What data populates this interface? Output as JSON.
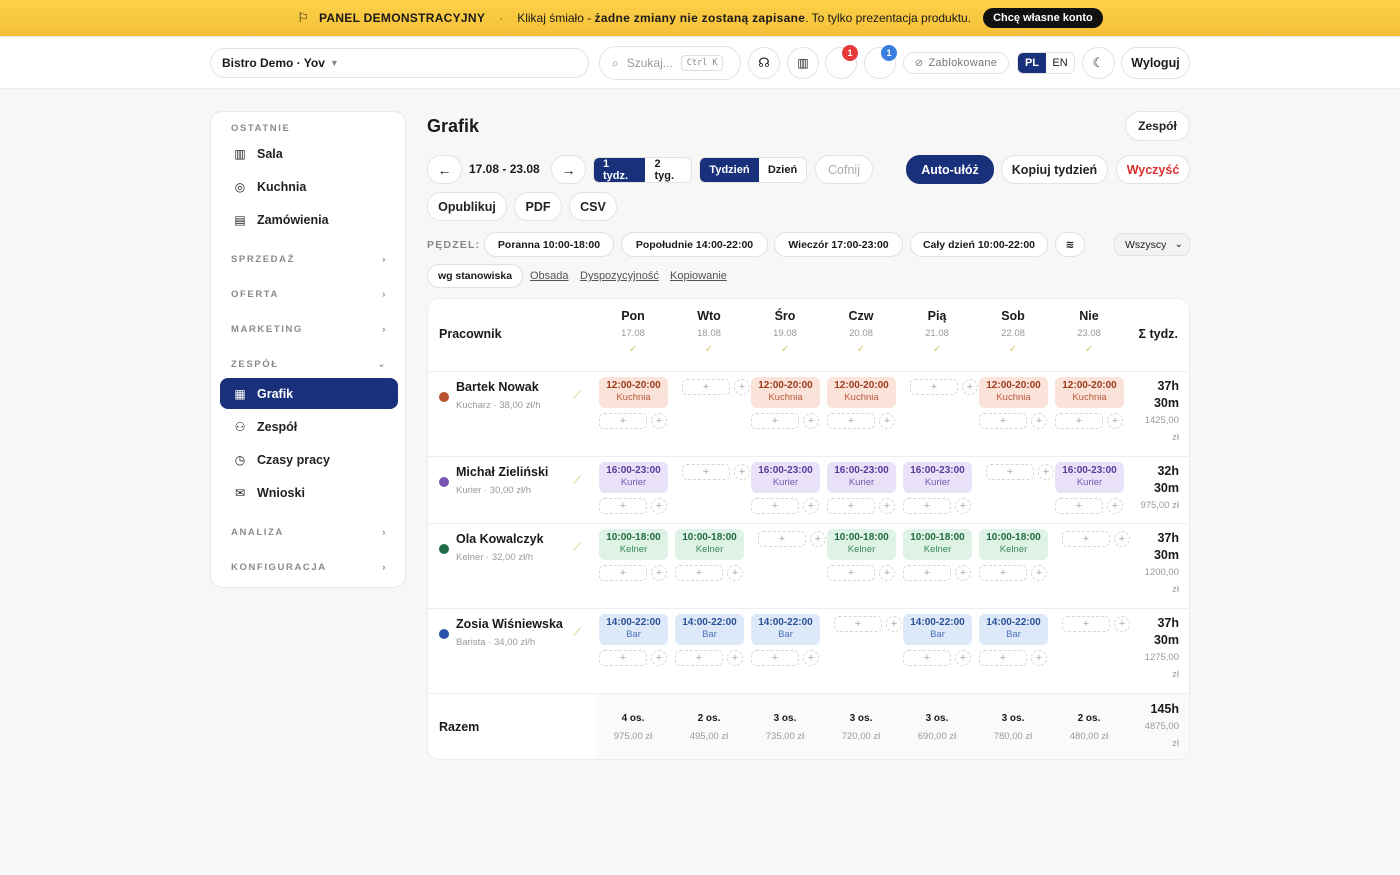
{
  "banner": {
    "title": "PANEL DEMONSTRACYJNY",
    "sep": "·",
    "text_a": "Klikaj śmiało - ",
    "text_b": "żadne zmiany nie zostaną zapisane",
    "text_c": ". To tylko prezentacja produktu.",
    "cta": "Chcę własne konto"
  },
  "topbar": {
    "restaurant": "Bistro Demo · Yov",
    "search_placeholder": "Szukaj...",
    "shortcut": "Ctrl K",
    "badge_a": "1",
    "badge_b": "1",
    "blocked": "Zablokowane",
    "lang_pl": "PL",
    "lang_en": "EN",
    "logout": "Wyloguj"
  },
  "sidebar": {
    "recent_label": "OSTATNIE",
    "recent": [
      {
        "label": "Sala"
      },
      {
        "label": "Kuchnia"
      },
      {
        "label": "Zamówienia"
      }
    ],
    "sections": {
      "sales": "SPRZEDAŻ",
      "offer": "OFERTA",
      "marketing": "MARKETING",
      "team": "ZESPÓŁ",
      "analysis": "ANALIZA",
      "config": "KONFIGURACJA"
    },
    "team_items": [
      {
        "label": "Grafik"
      },
      {
        "label": "Zespół"
      },
      {
        "label": "Czasy pracy"
      },
      {
        "label": "Wnioski"
      }
    ]
  },
  "page": {
    "title": "Grafik",
    "team_button": "Zespół"
  },
  "toolbar": {
    "prev": "←",
    "range": "17.08 - 23.08",
    "next": "→",
    "w1": "1 tydz.",
    "w2": "2 tyg.",
    "week": "Tydzień",
    "day": "Dzień",
    "undo": "Cofnij",
    "auto": "Auto-ułóż",
    "copy": "Kopiuj tydzień",
    "clear": "Wyczyść",
    "publish": "Opublikuj",
    "pdf": "PDF",
    "csv": "CSV"
  },
  "brush": {
    "label": "PĘDZEL:",
    "presets": [
      "Poranna 10:00-18:00",
      "Popołudnie 14:00-22:00",
      "Wieczór 17:00-23:00",
      "Cały dzień 10:00-22:00"
    ],
    "extra": "≋",
    "filter": "Wszyscy"
  },
  "views": {
    "active": "wg stanowiska",
    "links": [
      "Obsada",
      "Dyspozycyjność",
      "Kopiowanie"
    ]
  },
  "grid": {
    "emp_header": "Pracownik",
    "total_header": "Σ tydz.",
    "days": [
      {
        "name": "Pon",
        "date": "17.08"
      },
      {
        "name": "Wto",
        "date": "18.08"
      },
      {
        "name": "Śro",
        "date": "19.08"
      },
      {
        "name": "Czw",
        "date": "20.08"
      },
      {
        "name": "Pią",
        "date": "21.08"
      },
      {
        "name": "Sob",
        "date": "22.08"
      },
      {
        "name": "Nie",
        "date": "23.08"
      }
    ],
    "check": "✓",
    "add": "+",
    "employees": [
      {
        "name": "Bartek Nowak",
        "rate": "Kucharz · 38,00 zł/h",
        "color": "#b8502e",
        "hours": "37h",
        "minutes": "30m",
        "pay": "1425,00",
        "cur": "zł",
        "shift": {
          "time": "12:00-20:00",
          "role": "Kuchnia"
        }
      },
      {
        "name": "Michał Zieliński",
        "rate": "Kurier · 30,00 zł/h",
        "color": "#7a55b0",
        "hours": "32h",
        "minutes": "30m",
        "pay": "975,00 zł",
        "cur": "",
        "shift": {
          "time": "16:00-23:00",
          "role": "Kurier"
        }
      },
      {
        "name": "Ola Kowalczyk",
        "rate": "Kelner · 32,00 zł/h",
        "color": "#1f6b45",
        "hours": "37h",
        "minutes": "30m",
        "pay": "1200,00",
        "cur": "zł",
        "shift": {
          "time": "10:00-18:00",
          "role": "Kelner"
        }
      },
      {
        "name": "Zosia Wiśniewska",
        "rate": "Barista · 34,00 zł/h",
        "color": "#2a54a8",
        "hours": "37h",
        "minutes": "30m",
        "pay": "1275,00",
        "cur": "zł",
        "shift": {
          "time": "14:00-22:00",
          "role": "Bar"
        }
      }
    ],
    "summary": {
      "label": "Razem",
      "days": [
        {
          "os": "4 os.",
          "z": "975,00 zł"
        },
        {
          "os": "2 os.",
          "z": "495,00 zł"
        },
        {
          "os": "3 os.",
          "z": "735,00 zł"
        },
        {
          "os": "3 os.",
          "z": "720,00 zł"
        },
        {
          "os": "3 os.",
          "z": "690,00 zł"
        },
        {
          "os": "3 os.",
          "z": "780,00 zł"
        },
        {
          "os": "2 os.",
          "z": "480,00 zł"
        }
      ],
      "hours": "145h",
      "pay": "4875,00",
      "cur": "zł"
    }
  }
}
